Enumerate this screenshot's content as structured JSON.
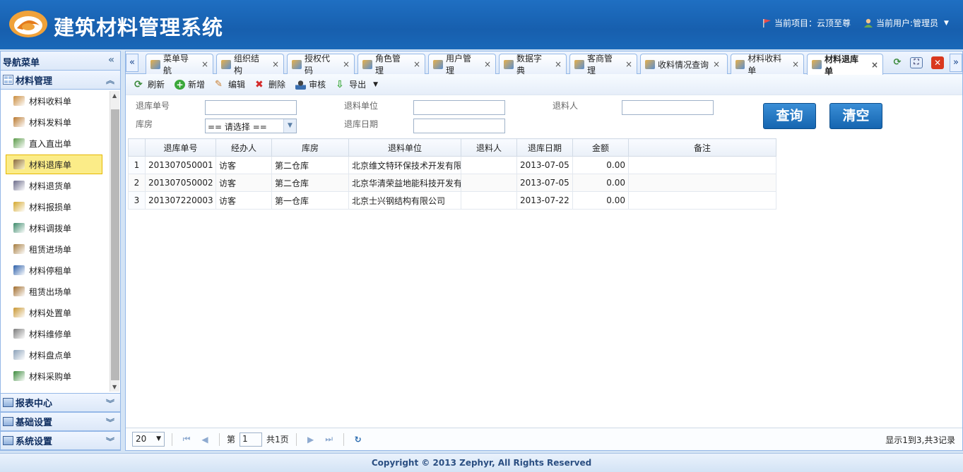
{
  "app": {
    "title": "建筑材料管理系统"
  },
  "header": {
    "project_label": "当前项目：云顶至尊",
    "user_label": "当前用户:管理员"
  },
  "sidebar": {
    "title": "导航菜单",
    "current_group": "材料管理",
    "items": [
      {
        "label": "材料收料单",
        "icon": "house-icon",
        "color": "#c98a3a"
      },
      {
        "label": "材料发料单",
        "icon": "house-out-icon",
        "color": "#b9772c"
      },
      {
        "label": "直入直出单",
        "icon": "form-icon",
        "color": "#5a9a48"
      },
      {
        "label": "材料退库单",
        "icon": "truck-icon",
        "color": "#8a6a3e",
        "active": true
      },
      {
        "label": "材料退货单",
        "icon": "truck-return-icon",
        "color": "#6b6b8a"
      },
      {
        "label": "材料报损单",
        "icon": "folder-icon",
        "color": "#d4a72c"
      },
      {
        "label": "材料调拨单",
        "icon": "transfer-icon",
        "color": "#3c8a6a"
      },
      {
        "label": "租赁进场单",
        "icon": "door-in-icon",
        "color": "#a57b3d"
      },
      {
        "label": "材料停租单",
        "icon": "pause-icon",
        "color": "#2b5ea8"
      },
      {
        "label": "租赁出场单",
        "icon": "door-out-icon",
        "color": "#a06b2a"
      },
      {
        "label": "材料处置单",
        "icon": "calendar-icon",
        "color": "#c8952f"
      },
      {
        "label": "材料维修单",
        "icon": "tools-icon",
        "color": "#7a7a7a"
      },
      {
        "label": "材料盘点单",
        "icon": "magnifier-icon",
        "color": "#8aa0b8"
      },
      {
        "label": "材料采购单",
        "icon": "cart-icon",
        "color": "#3b8a3b"
      }
    ],
    "groups": [
      {
        "label": "报表中心",
        "icon": "table-icon"
      },
      {
        "label": "基础设置",
        "icon": "book-icon"
      },
      {
        "label": "系统设置",
        "icon": "monitor-icon"
      }
    ]
  },
  "tabs": [
    {
      "label": "菜单导航",
      "icon": "sitemap-icon"
    },
    {
      "label": "组织结构",
      "icon": "org-icon"
    },
    {
      "label": "授权代码",
      "icon": "lock-icon"
    },
    {
      "label": "角色管理",
      "icon": "users-icon"
    },
    {
      "label": "用户管理",
      "icon": "user-icon"
    },
    {
      "label": "数据字典",
      "icon": "book-icon"
    },
    {
      "label": "客商管理",
      "icon": "merchant-icon"
    },
    {
      "label": "收料情况查询",
      "icon": "window-icon"
    },
    {
      "label": "材料收料单",
      "icon": "house-icon"
    },
    {
      "label": "材料退库单",
      "icon": "truck-icon",
      "selected": true
    }
  ],
  "toolbar": {
    "refresh": "刷新",
    "add": "新增",
    "edit": "编辑",
    "delete": "删除",
    "audit": "审核",
    "export": "导出"
  },
  "search": {
    "return_no_label": "退库单号",
    "unit_label": "退料单位",
    "person_label": "退料人",
    "warehouse_label": "库房",
    "warehouse_value": "== 请选择 ==",
    "date_label": "退库日期",
    "query_btn": "查询",
    "clear_btn": "清空"
  },
  "table": {
    "columns": [
      "退库单号",
      "经办人",
      "库房",
      "退料单位",
      "退料人",
      "退库日期",
      "金额",
      "备注"
    ],
    "rows": [
      {
        "n": "1",
        "no": "201307050001",
        "handler": "访客",
        "warehouse": "第二仓库",
        "unit": "北京维文特环保技术开发有限",
        "person": "",
        "date": "2013-07-05",
        "amount": "0.00",
        "note": ""
      },
      {
        "n": "2",
        "no": "201307050002",
        "handler": "访客",
        "warehouse": "第二仓库",
        "unit": "北京华清荣益地能科技开发有",
        "person": "",
        "date": "2013-07-05",
        "amount": "0.00",
        "note": ""
      },
      {
        "n": "3",
        "no": "201307220003",
        "handler": "访客",
        "warehouse": "第一仓库",
        "unit": "北京士兴钢结构有限公司",
        "person": "",
        "date": "2013-07-22",
        "amount": "0.00",
        "note": ""
      }
    ]
  },
  "pager": {
    "page_size": "20",
    "page_prefix": "第",
    "page_value": "1",
    "page_total": "共1页",
    "info": "显示1到3,共3记录"
  },
  "footer": {
    "copyright": "Copyright © 2013 Zephyr, All Rights Reserved"
  }
}
